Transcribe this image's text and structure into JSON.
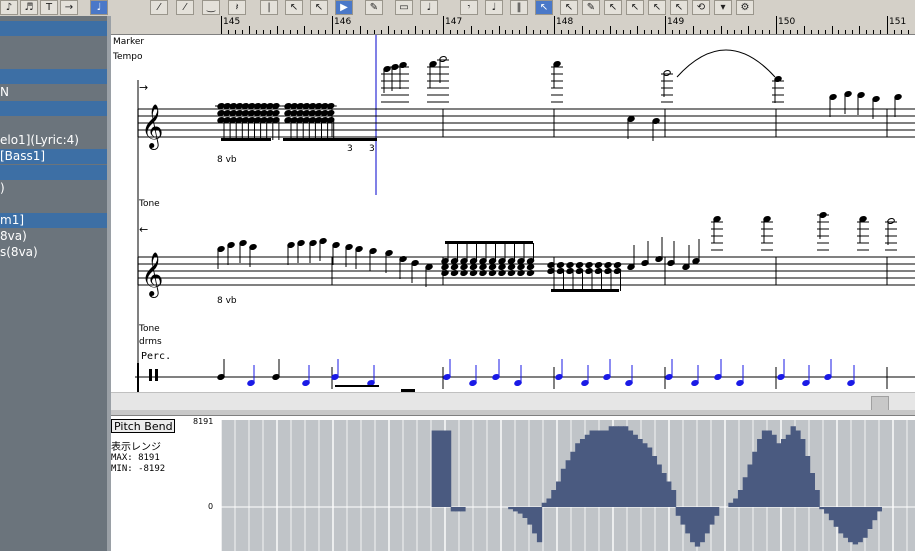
{
  "colors": {
    "toolbar_bg": "#d4d0c8",
    "track_panel_bg": "#6b747c",
    "track_selected_bg": "#3d6fa5",
    "playhead": "#0000cc",
    "perc_note": "#1a1ae6",
    "pitchbend_fill": "#4a5a80",
    "pitchbend_bg": "#c0c4c8"
  },
  "toolbar": {
    "icons": [
      "note-8-icon",
      "note-16-icon",
      "text-icon",
      "arrow-right-icon",
      "note-selected-icon",
      "slur-icon",
      "slur-red-icon",
      "tie-icon",
      "rest-icon",
      "stem-icon",
      "cursor-icon",
      "cursor-b-icon",
      "play-icon",
      "eraser-icon",
      "select-icon",
      "note-q-icon",
      "note-r-icon",
      "note-s-icon",
      "split-icon",
      "pointer-icon",
      "pointer2-icon",
      "pencil-icon",
      "pointer3-icon",
      "pointer4-icon",
      "pointer5-icon",
      "pointer6-icon",
      "loop-icon",
      "menu-icon",
      "tool-icon"
    ]
  },
  "tracks": {
    "rows": [
      {
        "label": "",
        "selected": true
      },
      {
        "label": "",
        "selected": false
      },
      {
        "label": "",
        "selected": false
      },
      {
        "label": "",
        "selected": true
      },
      {
        "label": "N",
        "selected": false
      },
      {
        "label": "",
        "selected": true
      },
      {
        "label": "",
        "selected": false
      },
      {
        "label": "elo1](Lyric:4)",
        "selected": false
      },
      {
        "label": "[Bass1]",
        "selected": true
      },
      {
        "label": "",
        "selected": true
      },
      {
        "label": ")",
        "selected": false
      },
      {
        "label": "",
        "selected": false
      },
      {
        "label": "m1]",
        "selected": true
      },
      {
        "label": "8va)",
        "selected": false
      },
      {
        "label": "s(8va)",
        "selected": false
      }
    ]
  },
  "ruler": {
    "measures": [
      "145",
      "146",
      "147",
      "148",
      "149",
      "150",
      "151"
    ]
  },
  "score": {
    "marker_label": "Marker",
    "tempo_label": "Tempo",
    "staff1": {
      "octave_mark": "8 vb",
      "arrow": "→",
      "tuplet": "3",
      "tone_label": "Tone"
    },
    "staff2": {
      "octave_mark": "8 vb",
      "arrow": "←",
      "tone_label": "Tone",
      "drums_label": "drms"
    },
    "perc": {
      "label": "Perc."
    }
  },
  "pitch_bend": {
    "button_label": "Pitch Bend",
    "range_label": "表示レンジ",
    "max_label": "MAX:  8191",
    "min_label": "MIN: -8192",
    "axis_top": "8191",
    "axis_zero": "0",
    "curve": [
      0,
      0,
      0,
      0,
      0,
      0,
      0,
      0,
      0,
      0,
      0,
      0,
      0,
      0,
      0,
      0,
      0,
      0,
      0,
      0,
      0,
      0,
      0,
      0,
      0,
      0,
      0,
      0,
      0,
      0,
      0,
      0,
      0,
      0,
      0,
      0,
      0,
      0,
      0,
      0,
      0,
      0,
      0,
      0,
      0.9,
      0.9,
      0.9,
      0.9,
      -0.1,
      -0.1,
      -0.1,
      0,
      0,
      0,
      0,
      0,
      0,
      0,
      0,
      0,
      -0.05,
      -0.1,
      -0.15,
      -0.25,
      -0.4,
      -0.6,
      -0.8,
      0.05,
      0.1,
      0.2,
      0.3,
      0.45,
      0.55,
      0.65,
      0.75,
      0.8,
      0.85,
      0.9,
      0.9,
      0.9,
      0.9,
      0.95,
      0.95,
      0.95,
      0.95,
      0.9,
      0.85,
      0.8,
      0.75,
      0.7,
      0.6,
      0.5,
      0.4,
      0.3,
      0.2,
      -0.2,
      -0.4,
      -0.6,
      -0.8,
      -0.9,
      -0.8,
      -0.6,
      -0.4,
      -0.2,
      0,
      0,
      0.05,
      0.1,
      0.2,
      0.35,
      0.5,
      0.65,
      0.8,
      0.9,
      0.9,
      0.85,
      0.75,
      0.8,
      0.85,
      0.95,
      0.9,
      0.8,
      0.6,
      0.4,
      0.2,
      -0.05,
      -0.15,
      -0.3,
      -0.45,
      -0.6,
      -0.7,
      -0.8,
      -0.85,
      -0.8,
      -0.7,
      -0.5,
      -0.3,
      -0.1,
      0,
      0,
      0,
      0,
      0,
      0,
      0
    ]
  }
}
